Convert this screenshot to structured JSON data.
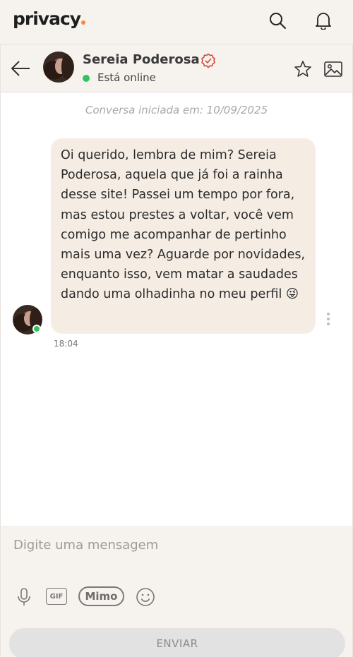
{
  "app": {
    "logo_text": "privacy",
    "brand_color": "#f58a3c",
    "icons": [
      "search-icon",
      "bell-icon"
    ]
  },
  "chat_header": {
    "contact_name": "Sereia Poderosa",
    "status": "Está online",
    "verified": true,
    "status_color": "#31c45e",
    "icons": [
      "back-arrow-icon",
      "verified-badge-icon",
      "star-icon",
      "gallery-icon"
    ]
  },
  "conversation": {
    "started_label": "Conversa iniciada em: 10/09/2025",
    "messages": [
      {
        "text": "Oi querido, lembra de mim? Sereia Poderosa, aquela que já foi a rainha desse site! Passei um tempo por fora, mas estou prestes a voltar, você vem comigo me acompanhar de pertinho mais uma vez? Aguarde por novidades, enquanto isso, vem matar a saudades dando uma olhadinha no meu perfil 😜",
        "time": "18:04"
      }
    ]
  },
  "composer": {
    "placeholder": "Digite uma mensagem",
    "gif_label": "GIF",
    "mimo_label": "Mimo",
    "send_label": "ENVIAR",
    "icons": [
      "microphone-icon",
      "gif-icon",
      "emoji-icon"
    ]
  }
}
